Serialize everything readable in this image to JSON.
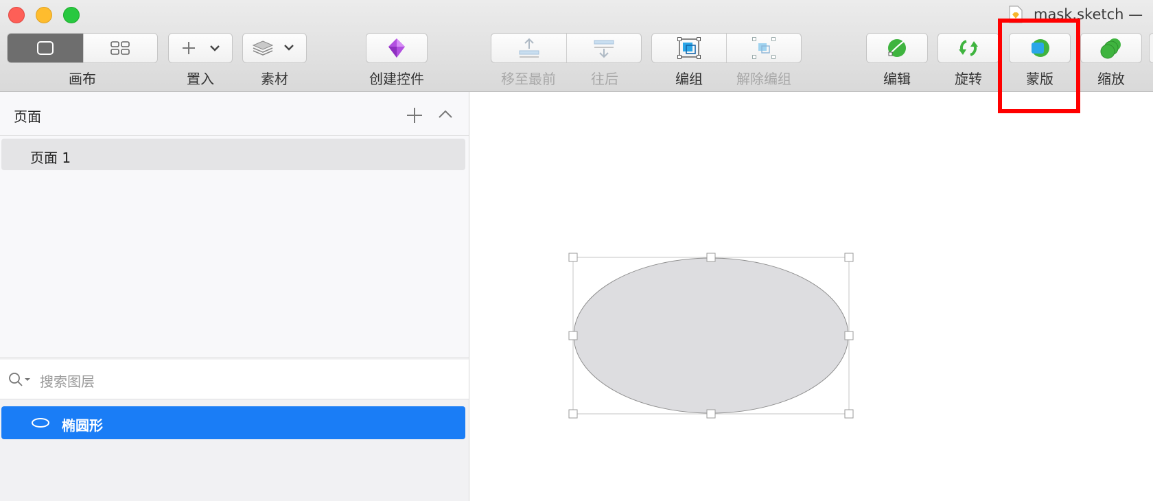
{
  "window": {
    "title": "mask.sketch —"
  },
  "toolbar": {
    "canvas_label": "画布",
    "insert_label": "置入",
    "assets_label": "素材",
    "create_symbol_label": "创建控件",
    "forward_label": "移至最前",
    "backward_label": "往后",
    "group_label": "编组",
    "ungroup_label": "解除编组",
    "edit_label": "编辑",
    "rotate_label": "旋转",
    "mask_label": "蒙版",
    "scale_label": "缩放"
  },
  "pages": {
    "title": "页面",
    "items": [
      {
        "label": "页面 1"
      }
    ]
  },
  "layers": {
    "search_placeholder": "搜索图层",
    "items": [
      {
        "label": "椭圆形",
        "icon": "oval-icon",
        "selected": true
      }
    ]
  },
  "colors": {
    "accent": "#1a7df6",
    "highlight": "#ff0000",
    "shape_fill": "#dddde0"
  }
}
